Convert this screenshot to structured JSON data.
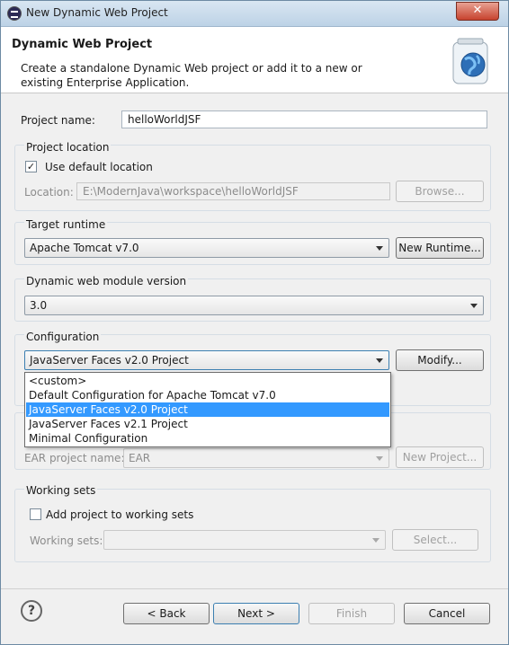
{
  "window": {
    "title": "New Dynamic Web Project",
    "close": "✕"
  },
  "header": {
    "title": "Dynamic Web Project",
    "description": "Create a standalone Dynamic Web project or add it to a new or existing Enterprise Application."
  },
  "project_name": {
    "label": "Project name:",
    "value": "helloWorldJSF"
  },
  "project_location": {
    "group_label": "Project location",
    "use_default_label": "Use default location",
    "use_default_checked": "✓",
    "location_label": "Location:",
    "location_value": "E:\\ModernJava\\workspace\\helloWorldJSF",
    "browse_label": "Browse..."
  },
  "target_runtime": {
    "group_label": "Target runtime",
    "selected": "Apache Tomcat v7.0",
    "new_runtime_label": "New Runtime..."
  },
  "module_version": {
    "group_label": "Dynamic web module version",
    "selected": "3.0"
  },
  "configuration": {
    "group_label": "Configuration",
    "selected": "JavaServer Faces v2.0 Project",
    "modify_label": "Modify...",
    "options": [
      "<custom>",
      "Default Configuration for Apache Tomcat v7.0",
      "JavaServer Faces v2.0 Project",
      "JavaServer Faces v2.1 Project",
      "Minimal Configuration"
    ]
  },
  "ear": {
    "name_label": "EAR project name:",
    "name_value": "EAR",
    "new_project_label": "New Project..."
  },
  "working_sets": {
    "group_label": "Working sets",
    "add_label": "Add project to working sets",
    "sets_label": "Working sets:",
    "select_label": "Select..."
  },
  "footer": {
    "help": "?",
    "back": "< Back",
    "next": "Next >",
    "finish": "Finish",
    "cancel": "Cancel"
  }
}
